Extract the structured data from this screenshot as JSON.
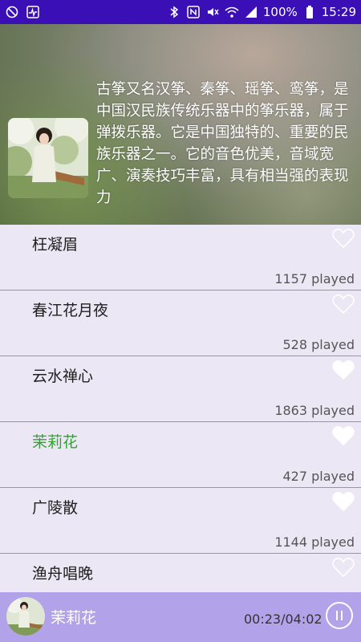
{
  "status_bar": {
    "battery": "100%",
    "time": "15:29",
    "icons_left": [
      "silent-app-icon",
      "pulse-app-icon"
    ],
    "icons_right": [
      "bluetooth-icon",
      "nfc-icon",
      "mute-icon",
      "wifi-icon",
      "signal-icon",
      "battery-icon"
    ]
  },
  "header": {
    "description": "古筝又名汉筝、秦筝、瑶筝、鸾筝，是中国汉民族传统乐器中的筝乐器，属于弹拨乐器。它是中国独特的、重要的民族乐器之一。它的音色优美，音域宽广、演奏技巧丰富，具有相当强的表现力"
  },
  "tracks": [
    {
      "title": "枉凝眉",
      "plays": "1157 played",
      "favorited": false,
      "active": false
    },
    {
      "title": "春江花月夜",
      "plays": "528 played",
      "favorited": false,
      "active": false
    },
    {
      "title": "云水禅心",
      "plays": "1863 played",
      "favorited": true,
      "active": false
    },
    {
      "title": "茉莉花",
      "plays": "427 played",
      "favorited": true,
      "active": true
    },
    {
      "title": "广陵散",
      "plays": "1144 played",
      "favorited": true,
      "active": false
    },
    {
      "title": "渔舟唱晚",
      "plays": "",
      "favorited": false,
      "active": false
    }
  ],
  "player": {
    "title": "茉莉花",
    "time": "00:23/04:02"
  },
  "colors": {
    "status_bar": "#3a10b6",
    "active_track": "#2ea62e",
    "player_bg": "#b1a2ea",
    "list_bg": "#ece7f4"
  }
}
